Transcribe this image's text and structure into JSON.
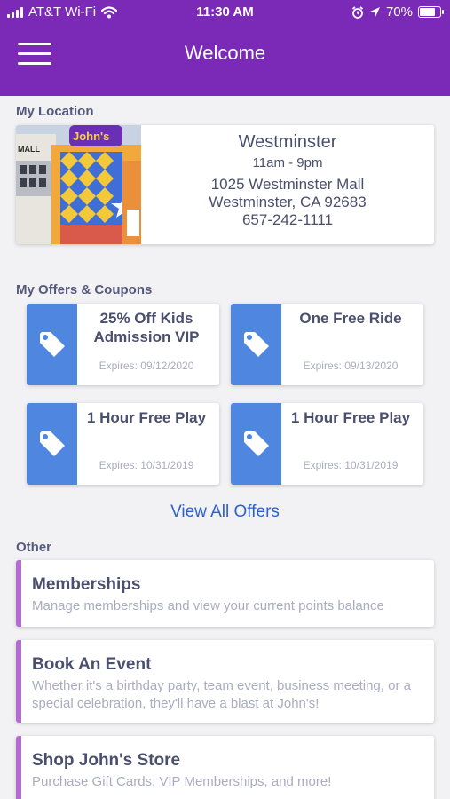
{
  "status_bar": {
    "carrier": "AT&T Wi-Fi",
    "time": "11:30 AM",
    "battery": "70%"
  },
  "header": {
    "title": "Welcome"
  },
  "location_section": {
    "label": "My Location",
    "name": "Westminster",
    "hours": "11am - 9pm",
    "address_line1": "1025 Westminster Mall",
    "address_line2": "Westminster, CA 92683",
    "phone": "657-242-1111",
    "photo_sign": "MALL",
    "photo_logo": "John's"
  },
  "offers_section": {
    "label": "My Offers & Coupons",
    "offers": [
      {
        "title": "25% Off Kids Admission VIP",
        "expires": "Expires: 09/12/2020"
      },
      {
        "title": "One Free Ride",
        "expires": "Expires: 09/13/2020"
      },
      {
        "title": "1 Hour Free Play",
        "expires": "Expires: 10/31/2019"
      },
      {
        "title": "1 Hour Free Play",
        "expires": "Expires: 10/31/2019"
      }
    ],
    "view_all": "View All Offers"
  },
  "other_section": {
    "label": "Other",
    "items": [
      {
        "title": "Memberships",
        "description": "Manage memberships and view your current points balance"
      },
      {
        "title": "Book An Event",
        "description": "Whether it's a birthday party, team event, business meeting, or a special celebration, they'll have a blast at John's!"
      },
      {
        "title": "Shop John's Store",
        "description": "Purchase Gift Cards, VIP Memberships, and more!"
      }
    ]
  },
  "colors": {
    "header": "#7b2ab7",
    "offer_tag": "#4e86e0",
    "other_accent": "#b46ad2",
    "link": "#2f5fcf"
  }
}
